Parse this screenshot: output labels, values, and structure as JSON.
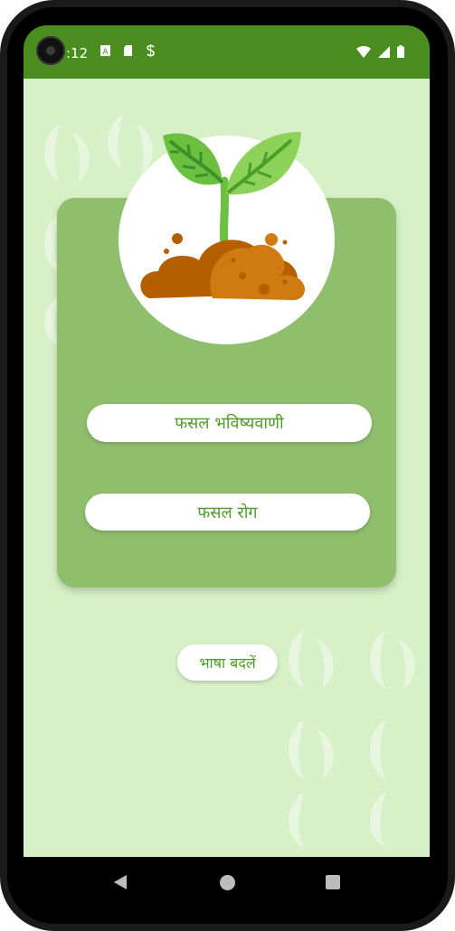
{
  "status_bar": {
    "time": ":12",
    "left_icons": [
      "a-notification-icon",
      "sd-card-icon",
      "s-sync-icon"
    ],
    "right_icons": [
      "wifi-icon",
      "signal-icon",
      "battery-icon"
    ]
  },
  "logo": {
    "icon": "seedling-soil-icon"
  },
  "buttons": {
    "crop_prediction": "फसल भविष्यवाणी",
    "crop_disease": "फसल रोग",
    "change_language": "भाषा बदलें"
  },
  "nav": {
    "back": "back-icon",
    "home": "home-icon",
    "recents": "recents-icon"
  },
  "colors": {
    "status_bar": "#4a8e1f",
    "background": "#d6f0c7",
    "card": "#8fbe6d",
    "button_text": "#4f9a28"
  }
}
